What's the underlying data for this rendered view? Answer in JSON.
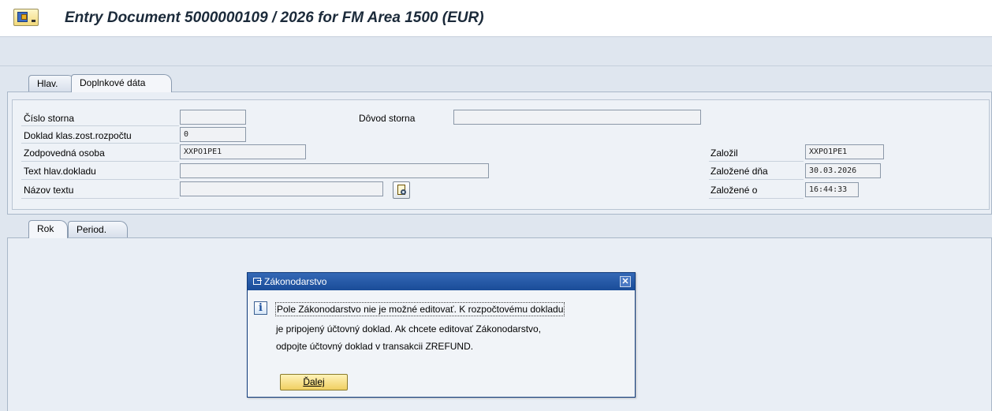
{
  "window": {
    "title": "Entry Document 5000000109 / 2026 for FM Area 1500 (EUR)",
    "title_icon": "document-screen-icon"
  },
  "tabs_top": [
    {
      "label": "Hlav.",
      "active": false
    },
    {
      "label": "Doplnkové dáta",
      "active": true
    }
  ],
  "form": {
    "cislo_storna": {
      "label": "Číslo storna",
      "value": ""
    },
    "dovod_storna": {
      "label": "Dôvod storna",
      "value": ""
    },
    "doklad_klas": {
      "label": "Doklad klas.zost.rozpočtu",
      "value": "0"
    },
    "zodpovedna_osoba": {
      "label": "Zodpovedná osoba",
      "value": "XXPO1PE1"
    },
    "text_hlav": {
      "label": "Text hlav.dokladu",
      "value": ""
    },
    "nazov_textu": {
      "label": "Názov textu",
      "value": ""
    },
    "text_button_icon": "display-text-icon",
    "zalozil": {
      "label": "Založil",
      "value": "XXPO1PE1"
    },
    "zalozene_dna": {
      "label": "Založené dňa",
      "value": "30.03.2026"
    },
    "zalozene_o": {
      "label": "Založené o",
      "value": "16:44:33"
    }
  },
  "tabs_bottom": [
    {
      "label": "Rok",
      "active": true
    },
    {
      "label": "Period.",
      "active": false
    }
  ],
  "dialog": {
    "title": "Zákonodarstvo",
    "icon": "info-icon",
    "lines": [
      "Pole Zákonodarstvo nie je možné editovať. K rozpočtovému dokladu",
      "je pripojený účtovný doklad. Ak chcete editovať Zákonodarstvo,",
      "odpojte účtovný doklad v transakcii ZREFUND."
    ],
    "button_label": "Ďalej"
  },
  "colors": {
    "background": "#dfe6ef",
    "dialog_title_bar": "#1a4c98",
    "button": "#f0cf62"
  }
}
